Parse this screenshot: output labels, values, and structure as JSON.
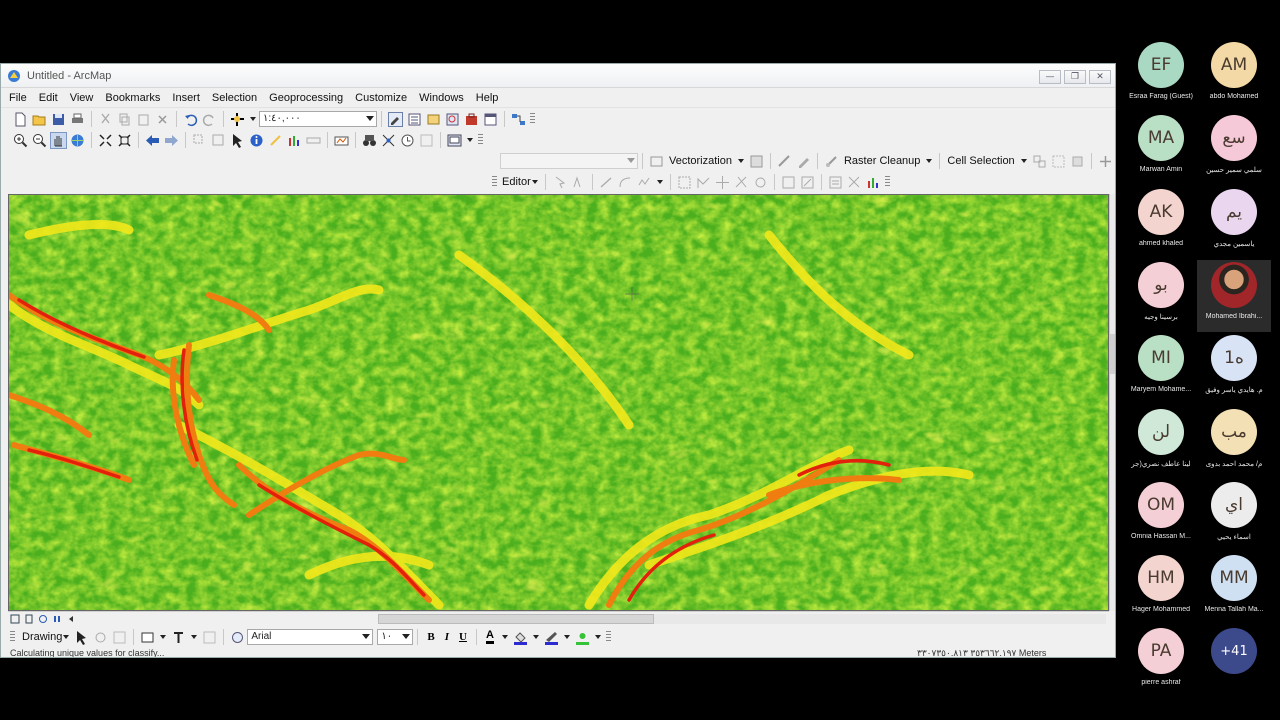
{
  "window": {
    "title": "Untitled - ArcMap",
    "buttons": [
      "—",
      "❐",
      "✕"
    ]
  },
  "menu": [
    "File",
    "Edit",
    "View",
    "Bookmarks",
    "Insert",
    "Selection",
    "Geoprocessing",
    "Customize",
    "Windows",
    "Help"
  ],
  "toolbar": {
    "scale_value": "١:٤٠,٠٠٠",
    "vectorization_label": "Vectorization",
    "raster_cleanup_label": "Raster Cleanup",
    "cell_selection_label": "Cell Selection",
    "editor_label": "Editor"
  },
  "drawing": {
    "label": "Drawing",
    "font_name": "Arial",
    "font_size": "١٠",
    "bold": "B",
    "italic": "I",
    "underline": "U",
    "font_color_glyph": "A",
    "font_color": "#000000",
    "fill_color": "#2b2bd0",
    "line_color": "#36c236"
  },
  "status": {
    "message": "Calculating unique values for classify...",
    "coordinates": "٣٥٣٦٦٢.١٩٧  ٣٣٠٧٣٥٠.٨١٣ Meters"
  },
  "participants": [
    {
      "initials": "EF",
      "name": "Esraa Farag (Guest)",
      "color": "#a9d8c3"
    },
    {
      "initials": "AM",
      "name": "abdo Mohamed",
      "color": "#f3d9a6"
    },
    {
      "initials": "MA",
      "name": "Marwan Amin",
      "color": "#b9dfc4"
    },
    {
      "initials": "سع",
      "name": "سلمي سمير حسين",
      "color": "#f5c9d8"
    },
    {
      "initials": "AK",
      "name": "ahmed khaled",
      "color": "#f3d4cf"
    },
    {
      "initials": "يم",
      "name": "ياسمين مجدي",
      "color": "#ead7ef"
    },
    {
      "initials": "بو",
      "name": "برسينا وجيه",
      "color": "#f5cfd6"
    },
    {
      "initials": "",
      "name": "Mohamed Ibrahi...",
      "color": "#2b2b2b",
      "video": true
    },
    {
      "initials": "MI",
      "name": "Maryem Mohame...",
      "color": "#b9dfc4"
    },
    {
      "initials": "ﻩ1",
      "name": "م. هايدي ياسر وفيق",
      "color": "#d8e3f5"
    },
    {
      "initials": "لن",
      "name": "لينا عاطف نصري(جر",
      "color": "#cfe8d7"
    },
    {
      "initials": "مب",
      "name": "م/ محمد احمد بدوى",
      "color": "#f3e0b5"
    },
    {
      "initials": "OM",
      "name": "Omnia Hassan M...",
      "color": "#f5cfd6"
    },
    {
      "initials": "اي",
      "name": "اسماء يحيي",
      "color": "#ececec"
    },
    {
      "initials": "HM",
      "name": "Hager Mohammed",
      "color": "#f3d4cf"
    },
    {
      "initials": "MM",
      "name": "Menna Tallah Ma...",
      "color": "#cfe0f3"
    },
    {
      "initials": "PA",
      "name": "pierre ashraf",
      "color": "#f5cfd6"
    },
    {
      "initials": "+41",
      "name": "",
      "color": "#3c4a8c",
      "overflow": true
    }
  ],
  "icons": {
    "app": "arcmap-icon",
    "map_cursor": "crosshair-cursor"
  }
}
